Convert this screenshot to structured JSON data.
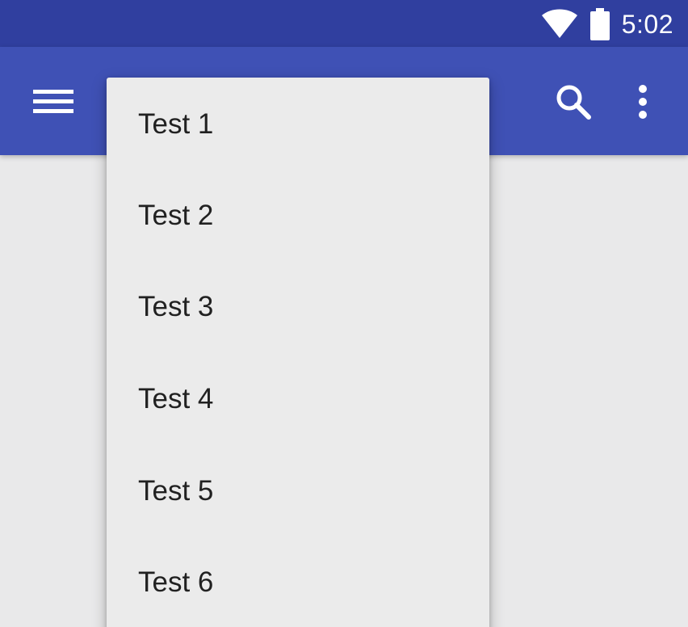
{
  "status_bar": {
    "time": "5:02",
    "icons": [
      "wifi-icon",
      "battery-icon"
    ],
    "color": "#303f9f"
  },
  "app_bar": {
    "color": "#3f51b5",
    "icons": [
      "menu-icon",
      "search-icon",
      "more-vert-icon"
    ]
  },
  "dropdown": {
    "items": [
      {
        "label": "Test 1"
      },
      {
        "label": "Test 2"
      },
      {
        "label": "Test 3"
      },
      {
        "label": "Test 4"
      },
      {
        "label": "Test 5"
      },
      {
        "label": "Test 6"
      }
    ]
  }
}
